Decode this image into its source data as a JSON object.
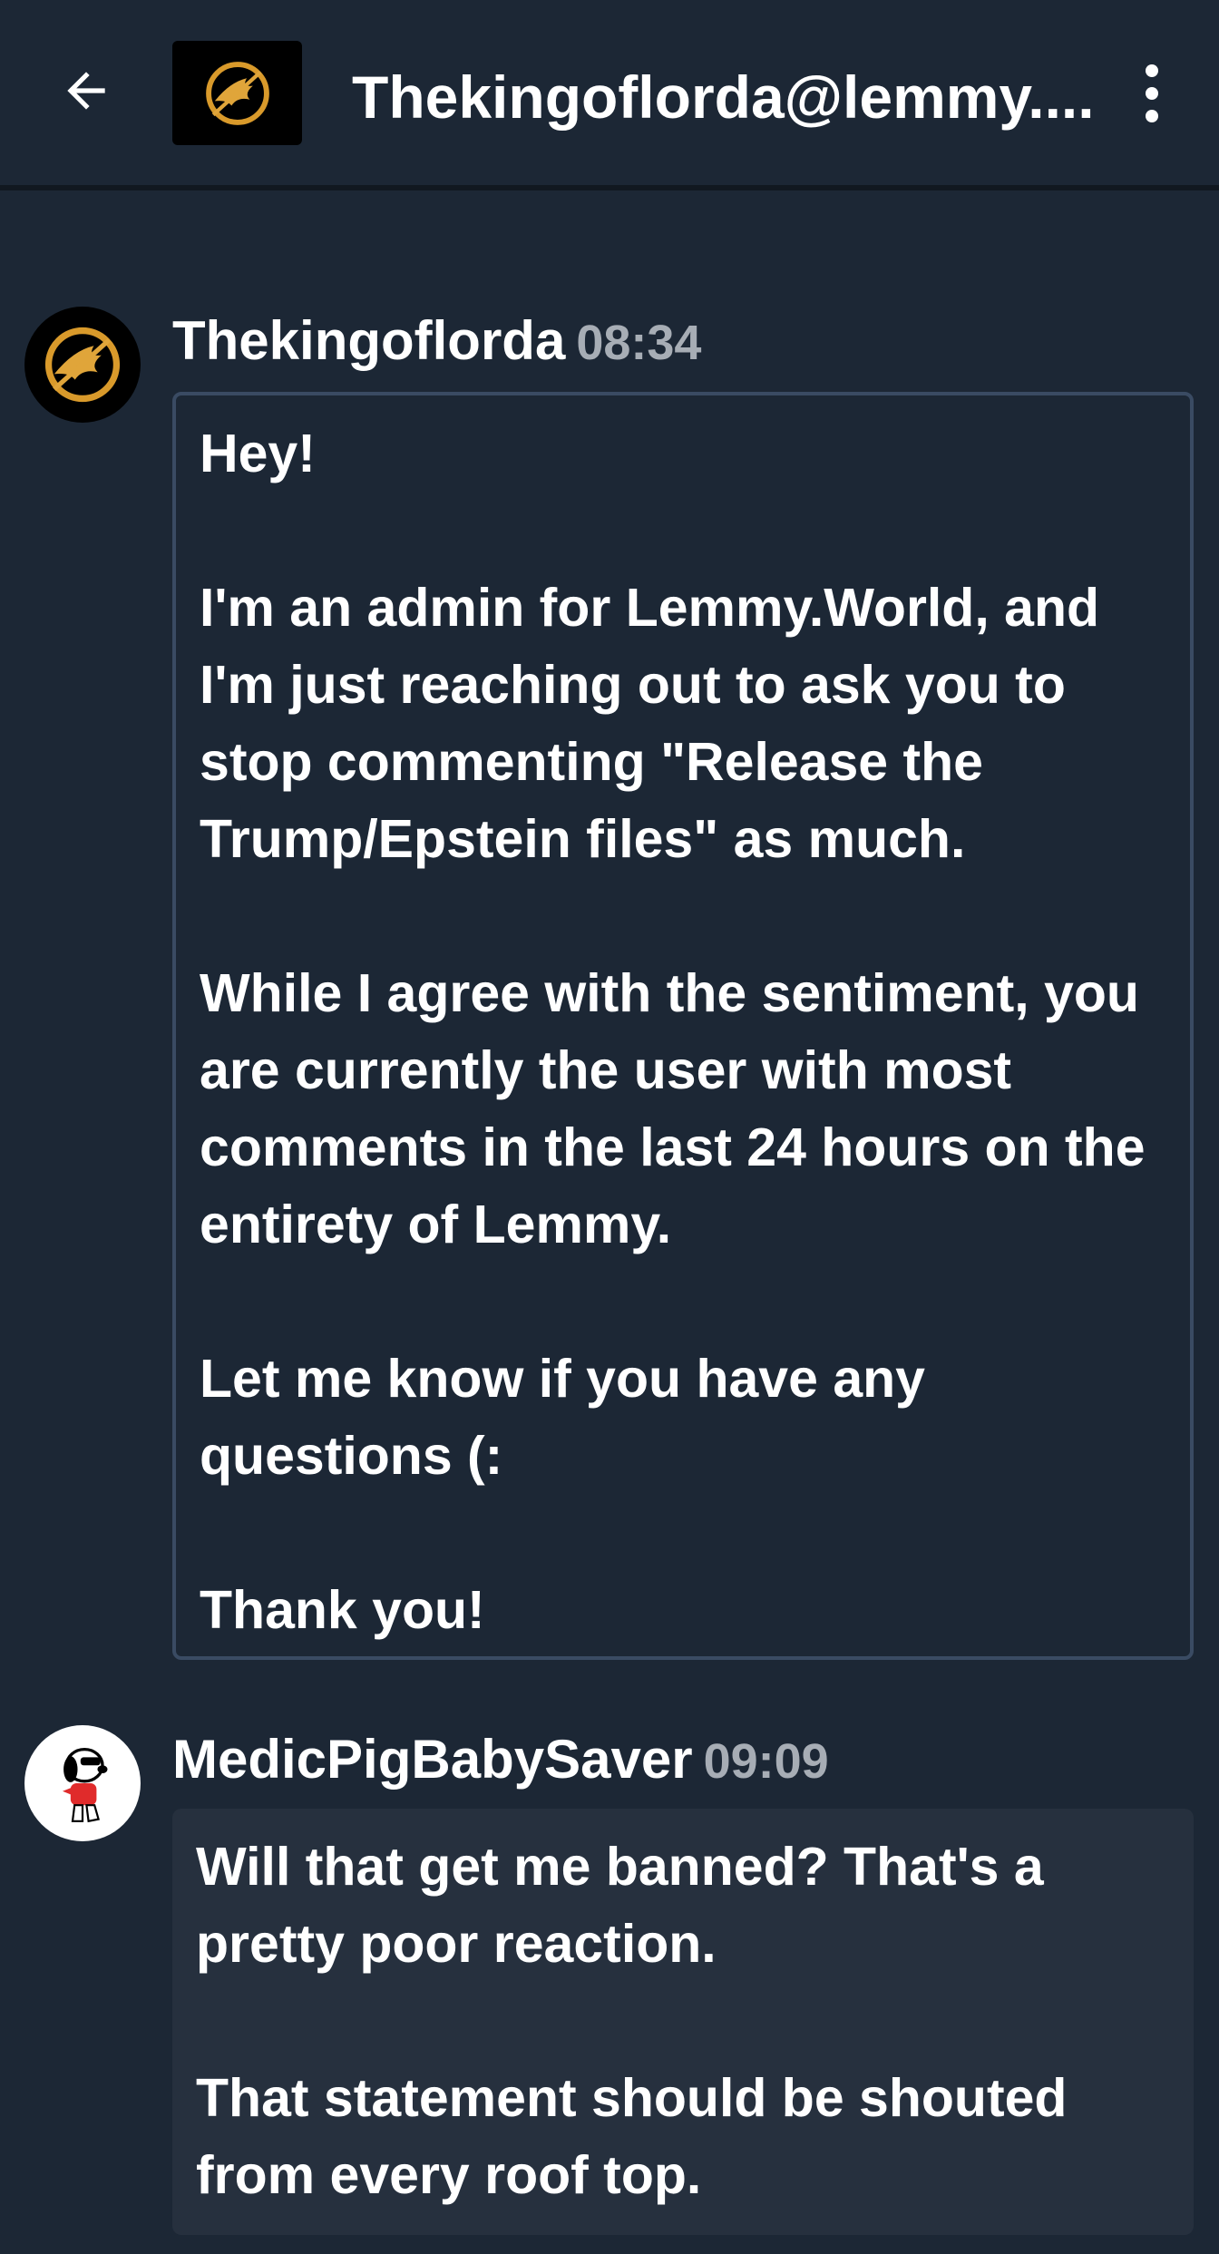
{
  "header": {
    "title": "Thekingoflorda@lemmy....",
    "back_icon": "arrow-left-icon",
    "avatar_icon": "mockingjay-logo",
    "menu_icon": "more-vertical-icon"
  },
  "messages": [
    {
      "author": "Thekingoflorda",
      "time": "08:34",
      "avatar_icon": "mockingjay-logo",
      "paragraphs": [
        "Hey!",
        "I'm an admin for Lemmy.World, and I'm just reaching out to ask you to stop commenting \"Release the Trump/Epstein files\" as much.",
        "While I agree with the sentiment, you are currently the user with most comments in the last 24 hours on the entirety of Lemmy.",
        "Let me know if you have any questions (:",
        "Thank you!"
      ]
    },
    {
      "author": "MedicPigBabySaver",
      "time": "09:09",
      "avatar_icon": "snoopy-avatar",
      "paragraphs": [
        "Will that get me banned? That's a pretty poor reaction.",
        "That statement should be shouted from every roof top."
      ]
    }
  ],
  "colors": {
    "background": "#1c2735",
    "bubble_outline": "#3a4b63",
    "bubble_fill": "#26303e",
    "timestamp": "#a7adb5"
  }
}
